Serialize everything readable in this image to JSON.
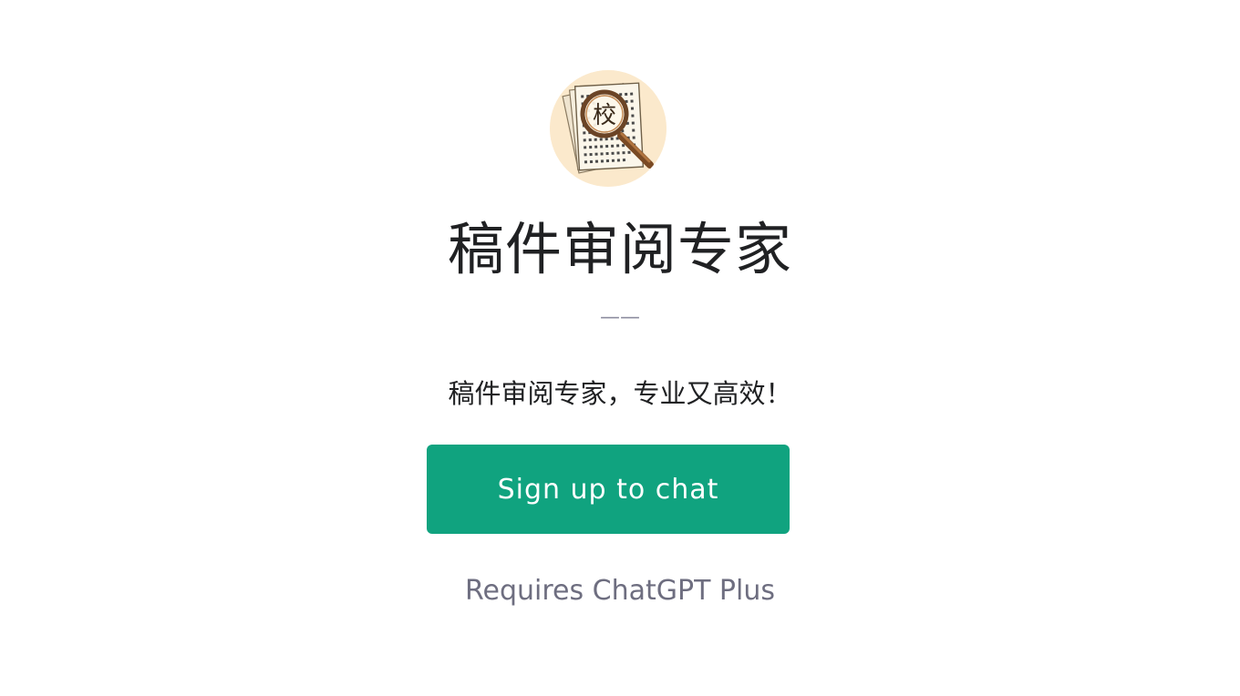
{
  "gpt": {
    "title": "稿件审阅专家",
    "divider": "——",
    "description": "稿件审阅专家，专业又高效！",
    "avatar_icon": "magnifying-glass-over-manuscript",
    "avatar_glyph": "校"
  },
  "actions": {
    "signup_label": "Sign up to chat",
    "requirement_note": "Requires ChatGPT Plus"
  },
  "colors": {
    "accent": "#10a37f",
    "avatar_background": "#fbe9cc",
    "text_primary": "#202123",
    "text_secondary": "#6e6e80"
  }
}
